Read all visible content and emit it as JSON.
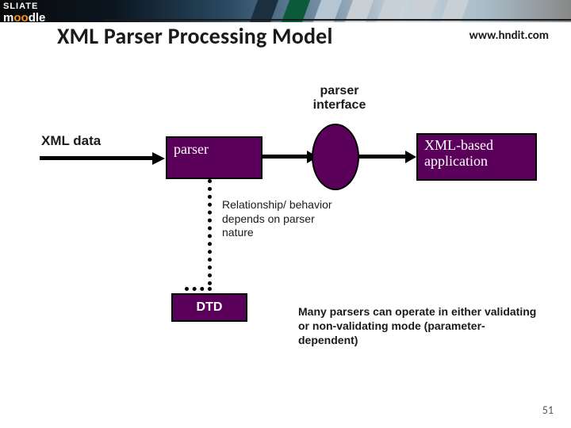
{
  "banner": {
    "logo_top": "SLIATE",
    "logo_bottom_html": "moodle"
  },
  "header": {
    "title": "XML Parser Processing Model",
    "url": "www.hndit.com"
  },
  "diagram": {
    "xml_data_label": "XML data",
    "parser_box": "parser",
    "interface_label": "parser interface",
    "app_box": "XML-based application",
    "relationship_text": "Relationship/ behavior depends on parser nature",
    "dtd_box": "DTD",
    "note": "Many parsers can operate in either validating or non-validating mode (parameter-dependent)"
  },
  "footer": {
    "page_number": "51"
  }
}
